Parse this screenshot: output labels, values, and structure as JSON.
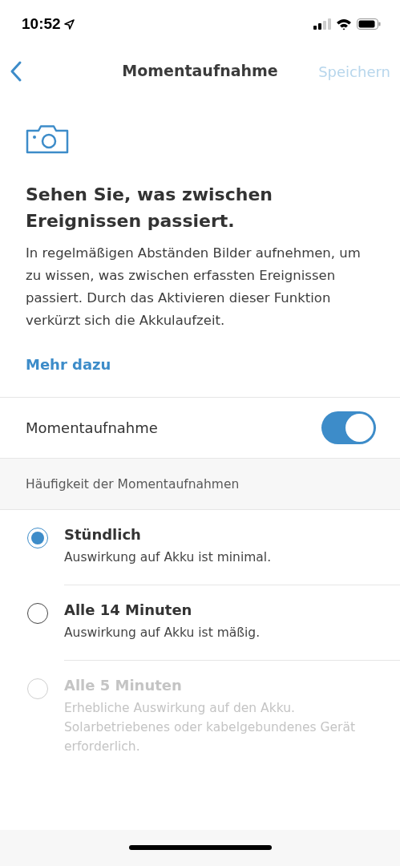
{
  "status_bar": {
    "time": "10:52"
  },
  "nav": {
    "title": "Momentaufnahme",
    "save": {
      "label": "Speichern",
      "disabled": true
    }
  },
  "intro": {
    "heading": "Sehen Sie, was zwischen Ereignissen passiert.",
    "body": "In regelmäßigen Abständen Bilder aufnehmen, um zu wissen, was zwischen erfassten Ereignissen passiert. Durch das Aktivieren dieser Funktion verkürzt sich die Akkulaufzeit.",
    "link": "Mehr dazu"
  },
  "toggle": {
    "label": "Momentaufnahme",
    "on": true
  },
  "section_header": "Häufigkeit der Momentaufnahmen",
  "options": [
    {
      "title": "Stündlich",
      "description": "Auswirkung auf Akku ist minimal.",
      "selected": true,
      "disabled": false
    },
    {
      "title": "Alle 14 Minuten",
      "description": "Auswirkung auf Akku ist mäßig.",
      "selected": false,
      "disabled": false
    },
    {
      "title": "Alle 5 Minuten",
      "description": "Erhebliche Auswirkung auf den Akku. Solarbetriebenes oder kabelgebundenes Gerät erforderlich.",
      "selected": false,
      "disabled": true
    }
  ]
}
